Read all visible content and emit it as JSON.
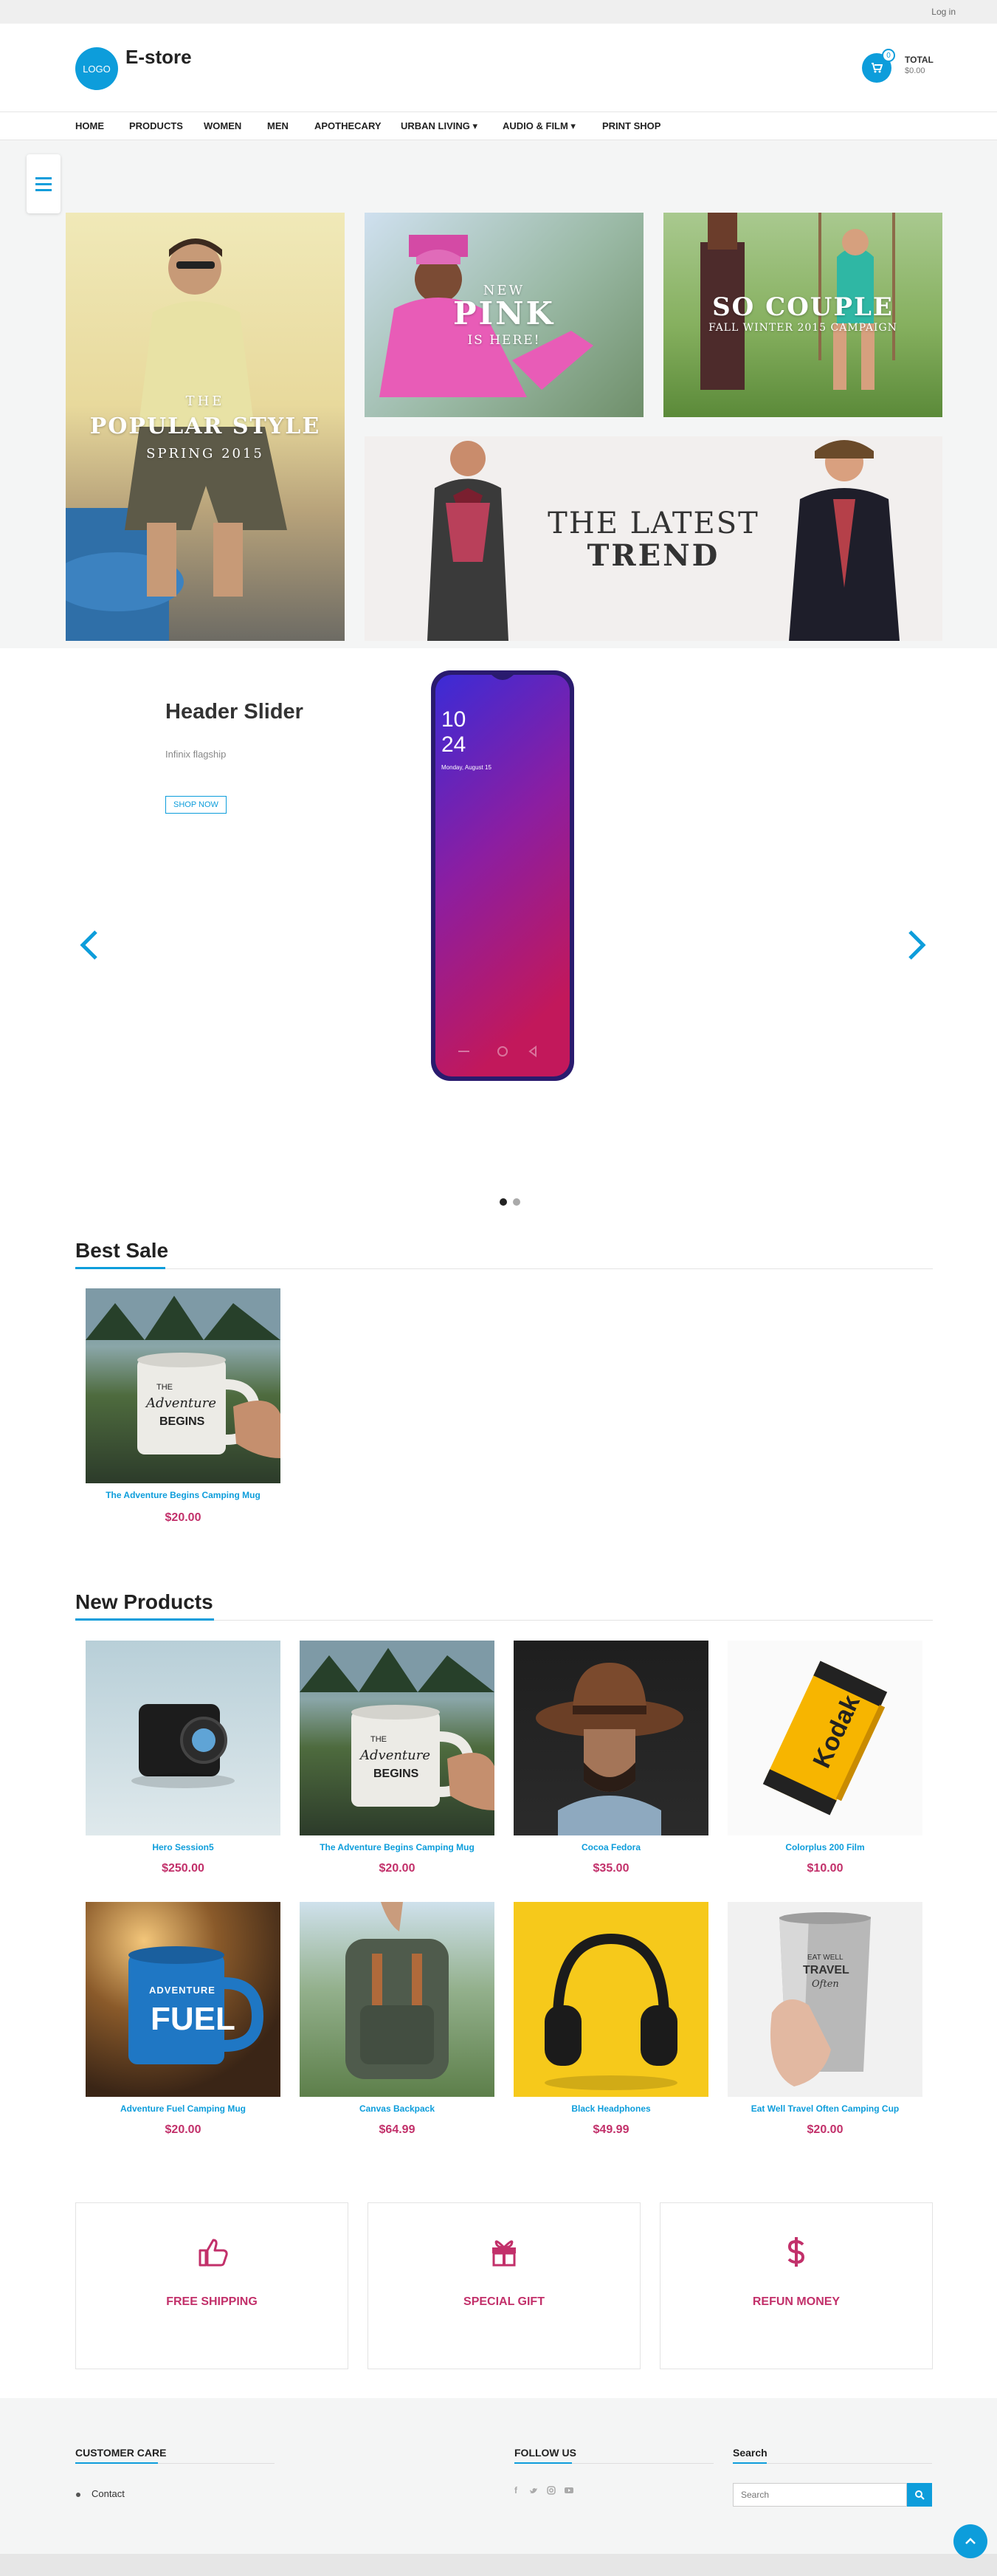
{
  "topbar": {
    "login": "Log in"
  },
  "header": {
    "logo_text": "LOGO",
    "brand": "E-store",
    "cart_count": "0",
    "total_label": "TOTAL",
    "total_value": "$0.00"
  },
  "nav": [
    {
      "label": "HOME"
    },
    {
      "label": "PRODUCTS"
    },
    {
      "label": "WOMEN"
    },
    {
      "label": "MEN"
    },
    {
      "label": "APOTHECARY"
    },
    {
      "label": "URBAN LIVING ▾"
    },
    {
      "label": "AUDIO & FILM ▾"
    },
    {
      "label": "PRINT SHOP"
    }
  ],
  "banners": {
    "popular": {
      "line1": "THE",
      "line2": "POPULAR STYLE",
      "line3": "SPRING 2015"
    },
    "pink": {
      "line1": "NEW",
      "line2": "PINK",
      "line3": "IS HERE!"
    },
    "couple": {
      "line1": "SO COUPLE",
      "line2": "FALL WINTER 2015 CAMPAIGN"
    },
    "trend": {
      "line1": "THE LATEST",
      "line2": "TREND"
    }
  },
  "slider": {
    "title": "Header Slider",
    "subtitle": "Infinix flagship",
    "button": "SHOP NOW",
    "phone_time": [
      "10",
      "24"
    ],
    "phone_date": "Monday, August 15",
    "prev_icon": "chevron-left-icon",
    "next_icon": "chevron-right-icon"
  },
  "best_sale": {
    "title": "Best Sale",
    "products": [
      {
        "name": "The Adventure Begins Camping Mug",
        "price": "$20.00"
      }
    ]
  },
  "new_products": {
    "title": "New Products",
    "products": [
      {
        "name": "Hero Session5",
        "price": "$250.00"
      },
      {
        "name": "The Adventure Begins Camping Mug",
        "price": "$20.00"
      },
      {
        "name": "Cocoa Fedora",
        "price": "$35.00"
      },
      {
        "name": "Colorplus 200 Film",
        "price": "$10.00"
      },
      {
        "name": "Adventure Fuel Camping Mug",
        "price": "$20.00"
      },
      {
        "name": "Canvas Backpack",
        "price": "$64.99"
      },
      {
        "name": "Black Headphones",
        "price": "$49.99"
      },
      {
        "name": "Eat Well Travel Often Camping Cup",
        "price": "$20.00"
      }
    ]
  },
  "product_art": {
    "mug_text": [
      "THE",
      "Adventure",
      "BEGINS"
    ],
    "film_text": "Kodak",
    "fuel_text": [
      "ADVENTURE",
      "FUEL"
    ],
    "cup_text": [
      "EAT WELL",
      "TRAVEL",
      "Often"
    ]
  },
  "features": [
    {
      "label": "FREE SHIPPING",
      "icon": "thumbs-up-icon"
    },
    {
      "label": "SPECIAL GIFT",
      "icon": "gift-icon"
    },
    {
      "label": "REFUN MONEY",
      "icon": "dollar-icon"
    }
  ],
  "footer": {
    "customer_care": "CUSTOMER CARE",
    "contact": "Contact",
    "follow_us": "FOLLOW US",
    "social_icons": [
      "facebook-icon",
      "twitter-icon",
      "instagram-icon",
      "youtube-icon"
    ],
    "search_title": "Search",
    "search_placeholder": "Search"
  },
  "colors": {
    "accent": "#0d9ddb",
    "price": "#c2306a"
  }
}
